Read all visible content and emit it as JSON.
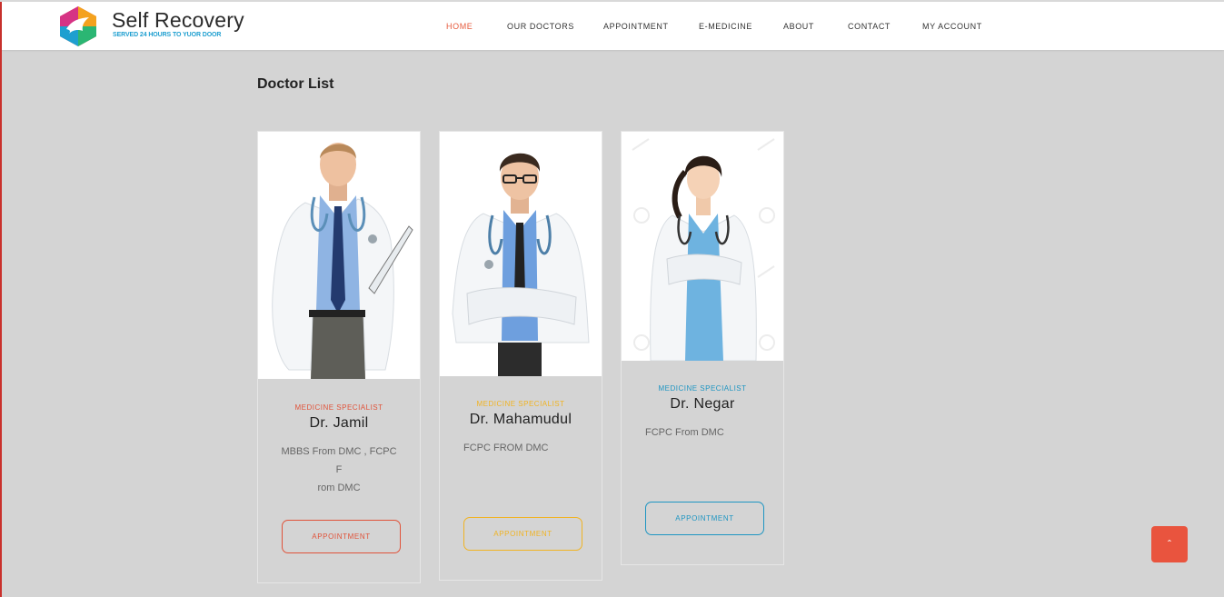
{
  "brand": {
    "title": "Self Recovery",
    "tagline": "SERVED 24 HOURS TO YUOR DOOR",
    "logo_icon": "hexagon-bird-logo"
  },
  "nav": {
    "items": [
      {
        "label": "HOME",
        "active": true
      },
      {
        "label": "OUR DOCTORS",
        "active": false
      },
      {
        "label": "APPOINTMENT",
        "active": false
      },
      {
        "label": "E-MEDICINE",
        "active": false
      },
      {
        "label": "ABOUT",
        "active": false
      },
      {
        "label": "CONTACT",
        "active": false
      },
      {
        "label": "MY ACCOUNT",
        "active": false
      }
    ],
    "active_color": "#e65a3c"
  },
  "page": {
    "title": "Doctor List"
  },
  "doctors": [
    {
      "specialty": "MEDICINE SPECIALIST",
      "name": "Dr. Jamil",
      "qualification_line1": "MBBS From DMC , FCPC F",
      "qualification_line2": "rom DMC",
      "button_label": "APPOINTMENT",
      "accent": "#e0533a"
    },
    {
      "specialty": "MEDICINE SPECIALIST",
      "name": "Dr. Mahamudul",
      "qualification_line1": "FCPC FROM DMC",
      "qualification_line2": "",
      "button_label": "APPOINTMENT",
      "accent": "#f0b323"
    },
    {
      "specialty": "MEDICINE SPECIALIST",
      "name": "Dr. Negar",
      "qualification_line1": "FCPC From DMC",
      "qualification_line2": "",
      "button_label": "APPOINTMENT",
      "accent": "#1e95c2"
    }
  ],
  "scroll_top": {
    "icon": "chevron-up-icon",
    "glyph": "ˆ",
    "color": "#e9543e"
  }
}
